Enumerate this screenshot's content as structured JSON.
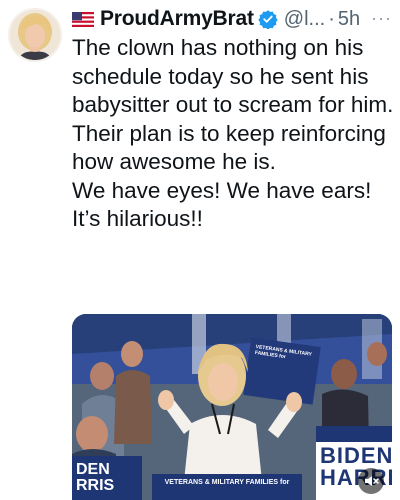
{
  "post": {
    "display_name": "ProudArmyBrat",
    "handle": "@l...",
    "separator": "·",
    "time": "5h",
    "more": "···",
    "paragraphs": [
      "The clown has nothing on his schedule today so he sent his babysitter out to scream for him.",
      "Their plan is to keep reinforcing how awesome he is.",
      "We have eyes! We have ears! It’s hilarious!!"
    ]
  },
  "media": {
    "type": "video",
    "signs": {
      "top_right": "VETERANS & MILITARY FAMILIES for",
      "campaign_right": "BIDEN HARRIS",
      "podium": "VETERANS & MILITARY FAMILIES for",
      "left_bottom": "DEN RRIS"
    }
  },
  "icons": {
    "flag": "us-flag-icon",
    "verified": "verified-badge-icon",
    "mute": "speaker-muted-icon"
  },
  "colors": {
    "verified": "#1d9bf0",
    "text": "#0f1419",
    "secondary": "#536471"
  }
}
